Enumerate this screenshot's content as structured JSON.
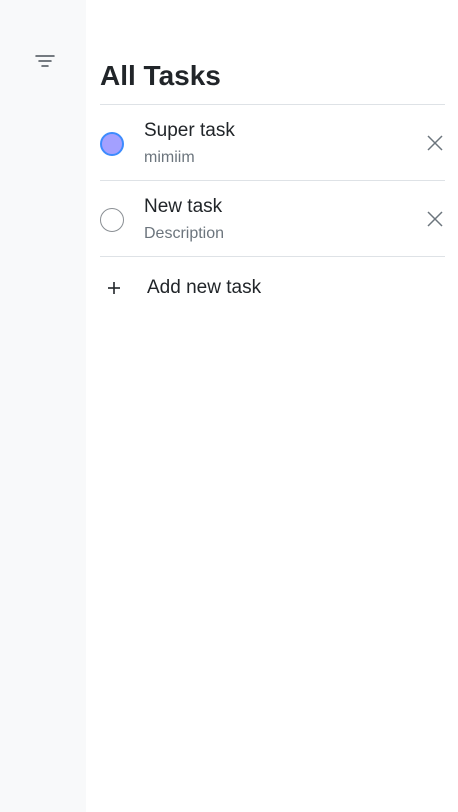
{
  "sidebar": {
    "filter_icon": "filter-lines-icon"
  },
  "main": {
    "title": "All Tasks",
    "tasks": [
      {
        "title": "Super task",
        "description": "mimiim",
        "completed": true
      },
      {
        "title": "New task",
        "description": "Description",
        "completed": false
      }
    ],
    "add_task_label": "Add new task",
    "add_icon": "plus-icon",
    "delete_icon": "close-icon"
  },
  "colors": {
    "sidebar_bg": "#f8f9fa",
    "check_fill": "#a3a0ff",
    "check_border": "#3d8bfd",
    "divider": "#dee2e6"
  }
}
